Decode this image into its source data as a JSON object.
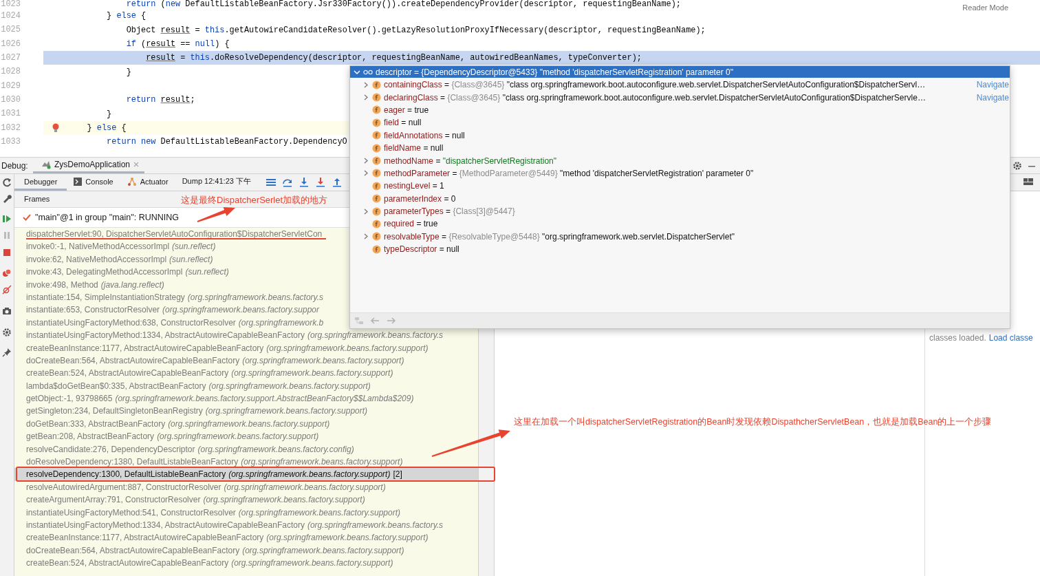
{
  "editor": {
    "reader_mode": "Reader Mode",
    "lines": [
      {
        "number": "1023",
        "tokens": [
          {
            "text": "            return",
            "kind": "keyword"
          },
          {
            "text": " (",
            "kind": "plain"
          },
          {
            "text": "new",
            "kind": "keyword"
          },
          {
            "text": " DefaultListableBeanFactory.Jsr330Factory()).createDependencyProvider(descriptor, requestingBeanName);",
            "kind": "plain"
          }
        ]
      },
      {
        "number": "1024",
        "tokens": [
          {
            "text": "        } ",
            "kind": "plain"
          },
          {
            "text": "else",
            "kind": "keyword"
          },
          {
            "text": " {",
            "kind": "plain"
          }
        ]
      },
      {
        "number": "1025",
        "tokens": [
          {
            "text": "            Object ",
            "kind": "plain"
          },
          {
            "text": "result",
            "kind": "variable"
          },
          {
            "text": " = ",
            "kind": "plain"
          },
          {
            "text": "this",
            "kind": "keyword"
          },
          {
            "text": ".getAutowireCandidateResolver().getLazyResolutionProxyIfNecessary(descriptor, requestingBeanName);",
            "kind": "plain"
          }
        ]
      },
      {
        "number": "1026",
        "tokens": [
          {
            "text": "            if",
            "kind": "keyword"
          },
          {
            "text": " (",
            "kind": "plain"
          },
          {
            "text": "result",
            "kind": "variable"
          },
          {
            "text": " == ",
            "kind": "plain"
          },
          {
            "text": "null",
            "kind": "keyword"
          },
          {
            "text": ") {",
            "kind": "plain"
          }
        ]
      },
      {
        "number": "1027",
        "execution_point": true,
        "tokens": [
          {
            "text": "                result",
            "kind": "variable"
          },
          {
            "text": " = ",
            "kind": "plain"
          },
          {
            "text": "this",
            "kind": "keyword"
          },
          {
            "text": ".doResolveDependency(descriptor, requestingBeanName, autowiredBeanNames, typeConverter);",
            "kind": "plain"
          }
        ]
      },
      {
        "number": "1028",
        "tokens": [
          {
            "text": "            }",
            "kind": "plain"
          }
        ]
      },
      {
        "number": "1029"
      },
      {
        "number": "1030",
        "tokens": [
          {
            "text": "            return ",
            "kind": "keyword"
          },
          {
            "text": "result",
            "kind": "variable"
          },
          {
            "text": ";",
            "kind": "plain"
          }
        ]
      },
      {
        "number": "1031",
        "tokens": [
          {
            "text": "        }",
            "kind": "plain"
          }
        ]
      },
      {
        "number": "1032",
        "caret_line": true,
        "bulb": true,
        "tokens": [
          {
            "text": "    } ",
            "kind": "plain"
          },
          {
            "text": "else",
            "kind": "keyword"
          },
          {
            "text": " {",
            "kind": "plain"
          }
        ]
      },
      {
        "number": "1033",
        "tokens": [
          {
            "text": "        return new",
            "kind": "keyword"
          },
          {
            "text": " DefaultListableBeanFactory.DependencyO",
            "kind": "plain"
          }
        ]
      }
    ]
  },
  "debug": {
    "label": "Debug:",
    "session_tab": "ZysDemoApplication",
    "tabs": [
      {
        "label": "Debugger",
        "kind": "debugger",
        "selected": true
      },
      {
        "label": "Console",
        "kind": "console",
        "selected": false
      },
      {
        "label": "Actuator",
        "kind": "actuator",
        "selected": false
      },
      {
        "label": "Dump 12:41:23 下午",
        "kind": "dump",
        "selected": false
      }
    ],
    "frames_title": "Frames",
    "thread": "\"main\"@1 in group \"main\": RUNNING",
    "frames": [
      {
        "location": "dispatcherServlet:90, DispatcherServletAutoConfiguration$DispatcherServletCon",
        "selected": false
      },
      {
        "location": "invoke0:-1, NativeMethodAccessorImpl",
        "package": "(sun.reflect)",
        "selected": false
      },
      {
        "location": "invoke:62, NativeMethodAccessorImpl",
        "package": "(sun.reflect)",
        "selected": false
      },
      {
        "location": "invoke:43, DelegatingMethodAccessorImpl",
        "package": "(sun.reflect)",
        "selected": false
      },
      {
        "location": "invoke:498, Method",
        "package": "(java.lang.reflect)",
        "selected": false
      },
      {
        "location": "instantiate:154, SimpleInstantiationStrategy",
        "package": "(org.springframework.beans.factory.s",
        "selected": false
      },
      {
        "location": "instantiate:653, ConstructorResolver",
        "package": "(org.springframework.beans.factory.suppor",
        "selected": false
      },
      {
        "location": "instantiateUsingFactoryMethod:638, ConstructorResolver",
        "package": "(org.springframework.b",
        "selected": false
      },
      {
        "location": "instantiateUsingFactoryMethod:1334, AbstractAutowireCapableBeanFactory",
        "package": "(org.springframework.beans.factory.s",
        "selected": false
      },
      {
        "location": "createBeanInstance:1177, AbstractAutowireCapableBeanFactory",
        "package": "(org.springframework.beans.factory.support)",
        "selected": false
      },
      {
        "location": "doCreateBean:564, AbstractAutowireCapableBeanFactory",
        "package": "(org.springframework.beans.factory.support)",
        "selected": false
      },
      {
        "location": "createBean:524, AbstractAutowireCapableBeanFactory",
        "package": "(org.springframework.beans.factory.support)",
        "selected": false
      },
      {
        "location": "lambda$doGetBean$0:335, AbstractBeanFactory",
        "package": "(org.springframework.beans.factory.support)",
        "selected": false
      },
      {
        "location": "getObject:-1, 93798665",
        "package": "(org.springframework.beans.factory.support.AbstractBeanFactory$$Lambda$209)",
        "selected": false
      },
      {
        "location": "getSingleton:234, DefaultSingletonBeanRegistry",
        "package": "(org.springframework.beans.factory.support)",
        "selected": false
      },
      {
        "location": "doGetBean:333, AbstractBeanFactory",
        "package": "(org.springframework.beans.factory.support)",
        "selected": false
      },
      {
        "location": "getBean:208, AbstractBeanFactory",
        "package": "(org.springframework.beans.factory.support)",
        "selected": false
      },
      {
        "location": "resolveCandidate:276, DependencyDescriptor",
        "package": "(org.springframework.beans.factory.config)",
        "selected": false
      },
      {
        "location": "doResolveDependency:1380, DefaultListableBeanFactory",
        "package": "(org.springframework.beans.factory.support)",
        "selected": false
      },
      {
        "location": "resolveDependency:1300, DefaultListableBeanFactory",
        "package": "(org.springframework.beans.factory.support)",
        "count": "[2]",
        "selected": true
      },
      {
        "location": "resolveAutowiredArgument:887, ConstructorResolver",
        "package": "(org.springframework.beans.factory.support)",
        "selected": false
      },
      {
        "location": "createArgumentArray:791, ConstructorResolver",
        "package": "(org.springframework.beans.factory.support)",
        "selected": false
      },
      {
        "location": "instantiateUsingFactoryMethod:541, ConstructorResolver",
        "package": "(org.springframework.beans.factory.support)",
        "selected": false
      },
      {
        "location": "instantiateUsingFactoryMethod:1334, AbstractAutowireCapableBeanFactory",
        "package": "(org.springframework.beans.factory.s",
        "selected": false
      },
      {
        "location": "createBeanInstance:1177, AbstractAutowireCapableBeanFactory",
        "package": "(org.springframework.beans.factory.support)",
        "selected": false
      },
      {
        "location": "doCreateBean:564, AbstractAutowireCapableBeanFactory",
        "package": "(org.springframework.beans.factory.support)",
        "selected": false
      },
      {
        "location": "createBean:524, AbstractAutowireCapableBeanFactory",
        "package": "(org.springframework.beans.factory.support)",
        "selected": false
      }
    ],
    "load_status": "classes loaded.",
    "load_link": "Load classe"
  },
  "popup": {
    "header": {
      "text": "descriptor = {DependencyDescriptor@5433} \"method 'dispatcherServletRegistration' parameter 0\"",
      "expanded": true
    },
    "fields": [
      {
        "name": "containingClass",
        "op": "=",
        "ref": "{Class@3645}",
        "value": "\"class org.springframework.boot.autoconfigure.web.servlet.DispatcherServletAutoConfiguration$DispatcherServl…",
        "expandable": true,
        "navigate": "Navigate"
      },
      {
        "name": "declaringClass",
        "op": "=",
        "ref": "{Class@3645}",
        "value": "\"class org.springframework.boot.autoconfigure.web.servlet.DispatcherServletAutoConfiguration$DispatcherServle…",
        "expandable": true,
        "navigate": "Navigate"
      },
      {
        "name": "eager",
        "op": "=",
        "value": "true",
        "expandable": false
      },
      {
        "name": "field",
        "op": "=",
        "value": "null",
        "expandable": false
      },
      {
        "name": "fieldAnnotations",
        "op": "=",
        "value": "null",
        "expandable": false
      },
      {
        "name": "fieldName",
        "op": "=",
        "value": "null",
        "expandable": false
      },
      {
        "name": "methodName",
        "op": "=",
        "value": "\"dispatcherServletRegistration\"",
        "string_value": true,
        "expandable": true
      },
      {
        "name": "methodParameter",
        "op": "=",
        "ref": "{MethodParameter@5449}",
        "value": "\"method 'dispatcherServletRegistration' parameter 0\"",
        "expandable": true
      },
      {
        "name": "nestingLevel",
        "op": "=",
        "value": "1",
        "expandable": false
      },
      {
        "name": "parameterIndex",
        "op": "=",
        "value": "0",
        "expandable": false
      },
      {
        "name": "parameterTypes",
        "op": "=",
        "ref": "{Class[3]@5447}",
        "expandable": true
      },
      {
        "name": "required",
        "op": "=",
        "value": "true",
        "expandable": false
      },
      {
        "name": "resolvableType",
        "op": "=",
        "ref": "{ResolvableType@5448}",
        "value": "\"org.springframework.web.servlet.DispatcherServlet\"",
        "expandable": true
      },
      {
        "name": "typeDescriptor",
        "op": "=",
        "value": "null",
        "expandable": false
      }
    ]
  },
  "annotations": [
    {
      "text": "这是最终DispatcherSerlet加载的地方"
    },
    {
      "text": "这里在加载一个叫dispatcherServletRegistration的Bean时发现依赖DispathcherServletBean，也就是加载Bean的上一个步骤"
    }
  ]
}
